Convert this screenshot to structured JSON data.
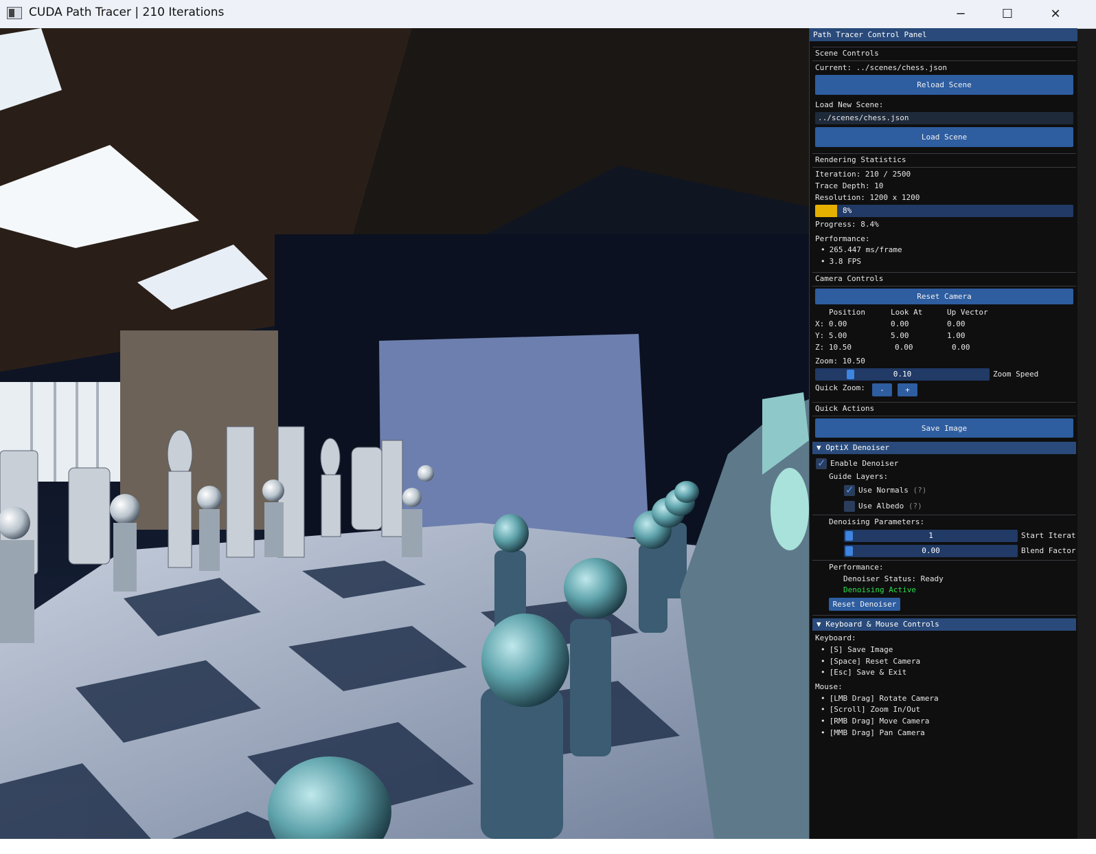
{
  "window": {
    "title": "CUDA Path Tracer | 210 Iterations",
    "minimize": "─",
    "maximize": "☐",
    "close": "✕"
  },
  "panel": {
    "title": "Path Tracer Control Panel",
    "scene": {
      "header": "Scene Controls",
      "current": "Current: ../scenes/chess.json",
      "reload_button": "Reload Scene",
      "load_label": "Load New Scene:",
      "load_input": "../scenes/chess.json",
      "load_button": "Load Scene"
    },
    "stats": {
      "header": "Rendering Statistics",
      "iteration": "Iteration: 210 / 2500",
      "trace_depth": "Trace Depth: 10",
      "resolution": "Resolution: 1200 x 1200",
      "progress_fraction": 0.084,
      "progress_bar_label": "8%",
      "progress_text": "Progress: 8.4%",
      "performance_label": "Performance:",
      "ms_per_frame": "265.447 ms/frame",
      "fps": "3.8 FPS"
    },
    "camera": {
      "header": "Camera Controls",
      "reset_button": "Reset Camera",
      "col_position": "Position",
      "col_look_at": "Look At",
      "col_up": "Up Vector",
      "rows": [
        {
          "label": "X: 0.00",
          "look": "0.00",
          "up": "0.00"
        },
        {
          "label": "Y: 5.00",
          "look": "5.00",
          "up": "1.00"
        },
        {
          "label": "Z: 10.50",
          "look": "0.00",
          "up": "0.00"
        }
      ],
      "zoom_text": "Zoom: 10.50",
      "zoom_speed_value": "0.10",
      "zoom_speed_label": "Zoom Speed",
      "quick_zoom_label": "Quick Zoom:",
      "zoom_minus": "-",
      "zoom_plus": "+"
    },
    "quick_actions": {
      "header": "Quick Actions",
      "save_button": "Save Image"
    },
    "denoiser": {
      "header": "▼  OptiX Denoiser",
      "enable_label": "Enable Denoiser",
      "enable_checked": true,
      "guide_label": "Guide Layers:",
      "use_normals": "Use Normals",
      "use_normals_checked": true,
      "use_albedo": "Use Albedo",
      "use_albedo_checked": false,
      "help": "(?)",
      "params_label": "Denoising Parameters:",
      "start_iter_value": "1",
      "start_iter_label": "Start Iterat",
      "blend_value": "0.00",
      "blend_label": "Blend Factor",
      "performance_label": "Performance:",
      "status": "Denoiser Status: Ready",
      "active": "Denoising Active",
      "reset_button": "Reset Denoiser"
    },
    "controls": {
      "header": "▼  Keyboard & Mouse Controls",
      "keyboard_label": "Keyboard:",
      "keyboard": [
        "[S] Save Image",
        "[Space] Reset Camera",
        "[Esc] Save & Exit"
      ],
      "mouse_label": "Mouse:",
      "mouse": [
        "[LMB Drag] Rotate Camera",
        "[Scroll] Zoom In/Out",
        "[RMB Drag] Move Camera",
        "[MMB Drag] Pan Camera"
      ]
    }
  }
}
